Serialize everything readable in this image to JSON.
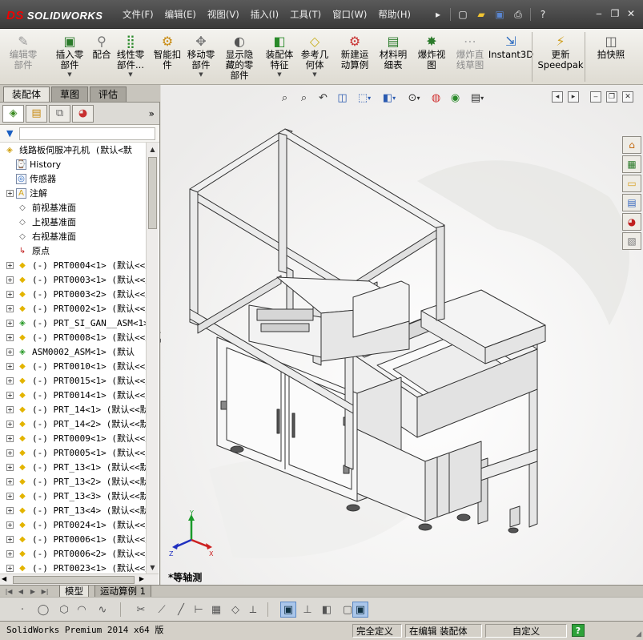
{
  "app": {
    "logo_ds": "DS",
    "logo_text": "SOLIDWORKS"
  },
  "menu": [
    "文件(F)",
    "编辑(E)",
    "视图(V)",
    "插入(I)",
    "工具(T)",
    "窗口(W)",
    "帮助(H)"
  ],
  "title_icons": [
    "pin-icon",
    "new-document-icon",
    "open-folder-icon",
    "save-icon",
    "print-icon",
    "help-icon"
  ],
  "window_controls": {
    "minimize": "‒",
    "restore": "❐",
    "close": "✕"
  },
  "command_manager": [
    {
      "label": "编辑零\n部件",
      "icon": "edit-component-icon",
      "disabled": true,
      "dropdown": false
    },
    {
      "label": "插入零\n部件",
      "icon": "insert-component-icon",
      "disabled": false,
      "dropdown": true
    },
    {
      "label": "配合",
      "icon": "mate-icon",
      "disabled": false,
      "dropdown": false
    },
    {
      "label": "线性零\n部件...",
      "icon": "linear-pattern-icon",
      "disabled": false,
      "dropdown": true
    },
    {
      "label": "智能扣\n件",
      "icon": "smart-fasteners-icon",
      "disabled": false,
      "dropdown": false
    },
    {
      "label": "移动零\n部件",
      "icon": "move-component-icon",
      "disabled": false,
      "dropdown": true
    },
    {
      "label": "显示隐\n藏的零\n部件",
      "icon": "show-hidden-icon",
      "disabled": false,
      "dropdown": false
    },
    {
      "label": "装配体\n特征",
      "icon": "assembly-features-icon",
      "disabled": false,
      "dropdown": true
    },
    {
      "label": "参考几\n何体",
      "icon": "reference-geometry-icon",
      "disabled": false,
      "dropdown": true
    },
    {
      "label": "新建运\n动算例",
      "icon": "new-motion-study-icon",
      "disabled": false,
      "dropdown": false
    },
    {
      "label": "材料明\n细表",
      "icon": "bom-icon",
      "disabled": false,
      "dropdown": false
    },
    {
      "label": "爆炸视\n图",
      "icon": "exploded-view-icon",
      "disabled": false,
      "dropdown": false
    },
    {
      "label": "爆炸直\n线草图",
      "icon": "explode-line-sketch-icon",
      "disabled": true,
      "dropdown": false
    },
    {
      "label": "Instant3D",
      "icon": "instant3d-icon",
      "disabled": false,
      "dropdown": false
    },
    {
      "label": "更新\nSpeedpak",
      "icon": "speedpak-icon",
      "disabled": false,
      "dropdown": false
    },
    {
      "label": "拍快照",
      "icon": "snapshot-icon",
      "disabled": false,
      "dropdown": false
    }
  ],
  "cmd_tabs": [
    {
      "label": "装配体",
      "active": true
    },
    {
      "label": "草图",
      "active": false
    },
    {
      "label": "评估",
      "active": false
    }
  ],
  "fm_tabs": [
    "feature-manager-icon",
    "property-manager-icon",
    "configuration-manager-icon",
    "display-manager-icon"
  ],
  "tree": [
    {
      "label": "线路板伺服冲孔机  (默认<默",
      "icon": "assembly-icon",
      "exp": "none"
    },
    {
      "label": "History",
      "icon": "history-icon",
      "exp": "none"
    },
    {
      "label": "传感器",
      "icon": "sensor-icon",
      "exp": "none"
    },
    {
      "label": "注解",
      "icon": "annotation-icon",
      "exp": "+"
    },
    {
      "label": "前视基准面",
      "icon": "plane-icon",
      "exp": "none"
    },
    {
      "label": "上视基准面",
      "icon": "plane-icon",
      "exp": "none"
    },
    {
      "label": "右视基准面",
      "icon": "plane-icon",
      "exp": "none"
    },
    {
      "label": "原点",
      "icon": "origin-icon",
      "exp": "none"
    },
    {
      "label": "(-) PRT0004<1> (默认<<默",
      "icon": "part-icon",
      "exp": "+"
    },
    {
      "label": "(-) PRT0003<1> (默认<<默",
      "icon": "part-icon",
      "exp": "+"
    },
    {
      "label": "(-) PRT0003<2> (默认<<默",
      "icon": "part-icon",
      "exp": "+"
    },
    {
      "label": "(-) PRT0002<1> (默认<<默",
      "icon": "part-icon",
      "exp": "+"
    },
    {
      "label": "(-) PRT_SI_GAN__ASM<1>",
      "icon": "subassembly-icon",
      "exp": "+"
    },
    {
      "label": "(-) PRT0008<1> (默认<<默",
      "icon": "part-icon",
      "exp": "+"
    },
    {
      "label": "ASM0002_ASM<1> (默认",
      "icon": "subassembly-icon",
      "exp": "+"
    },
    {
      "label": "(-) PRT0010<1> (默认<<默",
      "icon": "part-icon",
      "exp": "+"
    },
    {
      "label": "(-) PRT0015<1> (默认<<默",
      "icon": "part-icon",
      "exp": "+"
    },
    {
      "label": "(-) PRT0014<1> (默认<<默",
      "icon": "part-icon",
      "exp": "+"
    },
    {
      "label": "(-) PRT_14<1> (默认<<默",
      "icon": "part-icon",
      "exp": "+"
    },
    {
      "label": "(-) PRT_14<2> (默认<<默",
      "icon": "part-icon",
      "exp": "+"
    },
    {
      "label": "(-) PRT0009<1> (默认<<默",
      "icon": "part-icon",
      "exp": "+"
    },
    {
      "label": "(-) PRT0005<1> (默认<<默",
      "icon": "part-icon",
      "exp": "+"
    },
    {
      "label": "(-) PRT_13<1> (默认<<默",
      "icon": "part-icon",
      "exp": "+"
    },
    {
      "label": "(-) PRT_13<2> (默认<<默",
      "icon": "part-icon",
      "exp": "+"
    },
    {
      "label": "(-) PRT_13<3> (默认<<默",
      "icon": "part-icon",
      "exp": "+"
    },
    {
      "label": "(-) PRT_13<4> (默认<<默",
      "icon": "part-icon",
      "exp": "+"
    },
    {
      "label": "(-) PRT0024<1> (默认<<默",
      "icon": "part-icon",
      "exp": "+"
    },
    {
      "label": "(-) PRT0006<1> (默认<<默",
      "icon": "part-icon",
      "exp": "+"
    },
    {
      "label": "(-) PRT0006<2> (默认<<默",
      "icon": "part-icon",
      "exp": "+"
    },
    {
      "label": "(-) PRT0023<1> (默认<<默",
      "icon": "part-icon",
      "exp": "+"
    }
  ],
  "viewport": {
    "view_label": "*等轴测",
    "triad": {
      "x": "X",
      "y": "Y",
      "z": "Z"
    },
    "heads_up_icons": [
      "zoom-to-fit-icon",
      "zoom-area-icon",
      "previous-view-icon",
      "section-view-icon",
      "view-orientation-icon",
      "display-style-icon",
      "hide-show-icon",
      "edit-appearance-icon",
      "apply-scene-icon",
      "view-settings-icon"
    ],
    "task_pane_icons": [
      "home-icon",
      "design-library-icon",
      "file-explorer-icon",
      "view-palette-icon",
      "appearances-icon",
      "custom-properties-icon"
    ]
  },
  "bottom_tabs": [
    {
      "label": "模型",
      "active": true
    },
    {
      "label": "运动算例 1",
      "active": false
    }
  ],
  "sketch_toolbar_icons": [
    "point-icon",
    "circle-icon",
    "polygon-icon",
    "arc-icon",
    "spline-icon",
    "trim-icon",
    "offset-icon",
    "line-icon",
    "dimension-icon",
    "grid-icon",
    "plane-icon",
    "relations-icon",
    "display-icon",
    "view-orient-icon",
    "view-3d-icon"
  ],
  "status": {
    "app_version": "SolidWorks Premium 2014 x64 版",
    "definition": "完全定义",
    "mode": "在编辑 装配体",
    "units": "自定义",
    "help": "?"
  },
  "colors": {
    "title_bg": "#4a4a4a",
    "accent": "#e00000",
    "active_tab": "#e8e6e0",
    "part_icon": "#e3b400"
  }
}
